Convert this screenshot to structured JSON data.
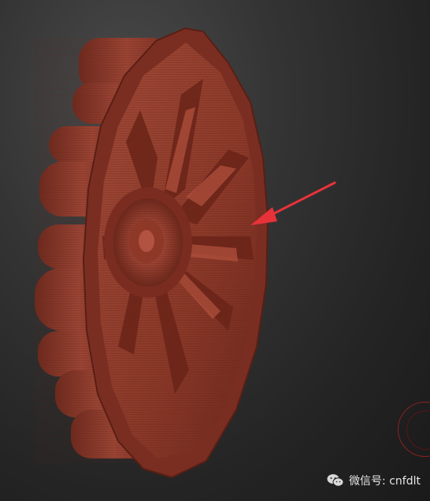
{
  "viewport": {
    "background": "#2a2a2a",
    "model": {
      "name": "sculpted-gear-wheel",
      "color": "#8b3a2c"
    },
    "annotation_arrow_color": "#e8323a"
  },
  "watermark": {
    "icon": "wechat-icon",
    "text": "微信号: cnfdlt"
  }
}
